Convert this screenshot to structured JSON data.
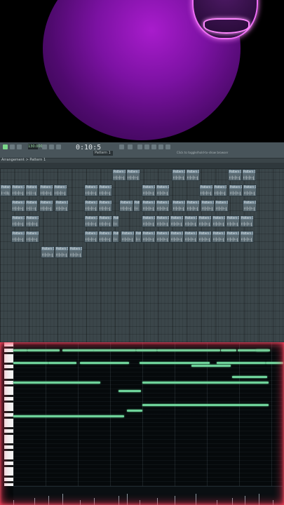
{
  "webcam": {
    "subject": "purge-mask-person"
  },
  "toolbar": {
    "time": "0:10:5",
    "bpm": "130.000",
    "pattern": "Pattern 1",
    "hint": "Click to toggle/hold-to-show browser"
  },
  "breadcrumb": "Arrangement > Pattern 1",
  "clip_label": "Pattern 1",
  "pattern_tag": "Pattern 2",
  "colors": {
    "note": "#6fd29a",
    "glow": "#ff3a5a",
    "playlist_bg": "#3b464a"
  }
}
